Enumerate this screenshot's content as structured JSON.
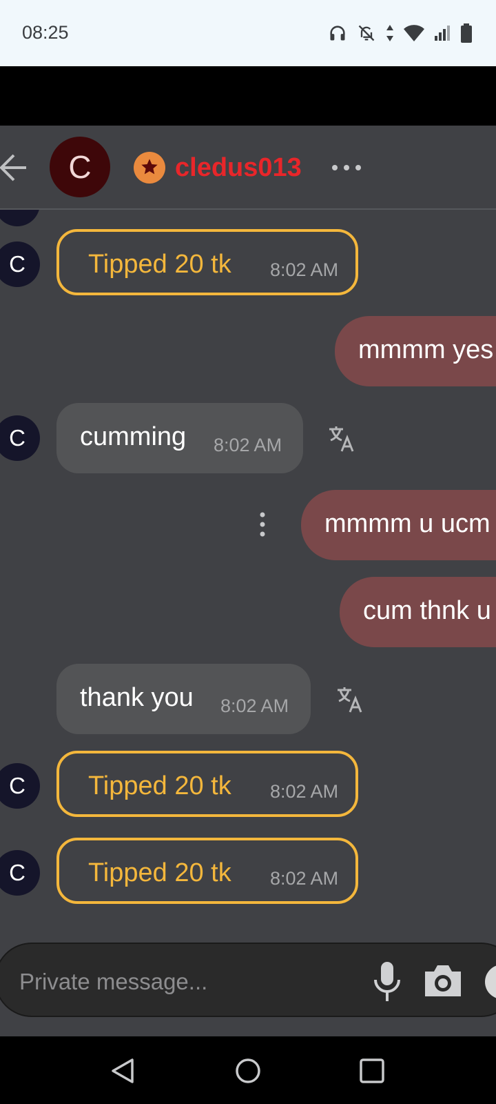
{
  "status_bar": {
    "time": "08:25",
    "icons": [
      "headphones-icon",
      "bell-off-icon",
      "data-arrows-icon",
      "wifi-icon",
      "signal-icon",
      "battery-icon"
    ]
  },
  "header": {
    "avatar_letter": "C",
    "badge_icon": "star-icon",
    "username": "cledus013",
    "colors": {
      "username": "#e8262a",
      "badge": "#ea8a3e"
    }
  },
  "messages": [
    {
      "type": "tip",
      "avatar": "C",
      "text": "Tipped 20 tk",
      "time": "8:02 AM"
    },
    {
      "type": "outgoing",
      "text": "mmmm yes"
    },
    {
      "type": "incoming",
      "avatar": "C",
      "text": "cumming",
      "time": "8:02 AM"
    },
    {
      "type": "outgoing",
      "text": "mmmm u ucm"
    },
    {
      "type": "outgoing",
      "text": "cum thnk u"
    },
    {
      "type": "incoming",
      "text": "thank you",
      "time": "8:02 AM"
    },
    {
      "type": "tip",
      "avatar": "C",
      "text": "Tipped 20 tk",
      "time": "8:02 AM"
    },
    {
      "type": "tip",
      "avatar": "C",
      "text": "Tipped 20 tk",
      "time": "8:02 AM"
    }
  ],
  "composer": {
    "placeholder": "Private message...",
    "value": ""
  },
  "colors": {
    "chat_background": "#404145",
    "tip_accent": "#f4b73c",
    "incoming_bubble": "#535456",
    "outgoing_bubble": "#7a484a"
  }
}
